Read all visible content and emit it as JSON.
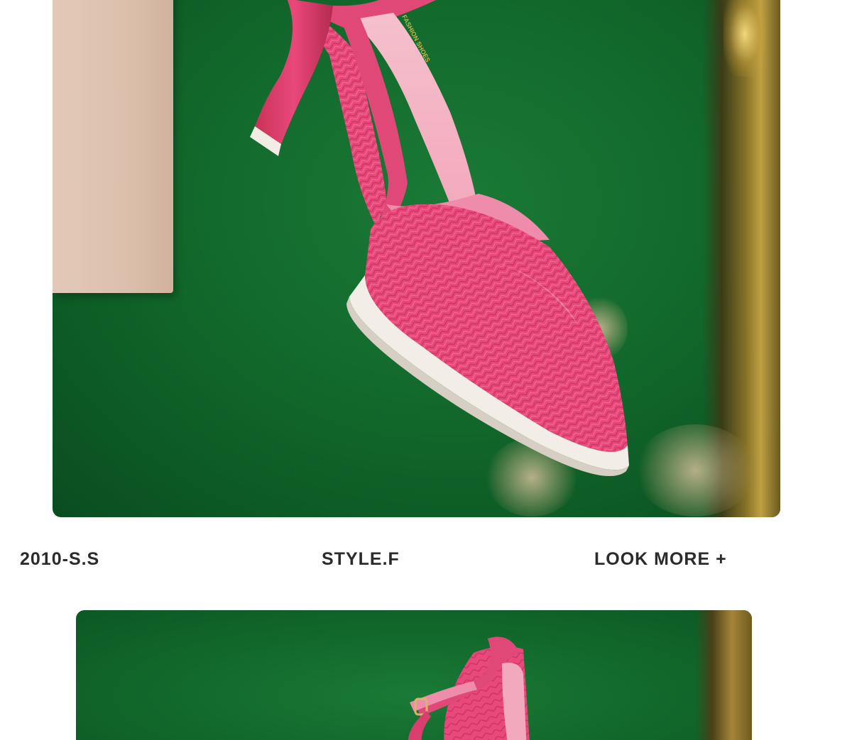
{
  "captions": {
    "season": "2010-S.S",
    "style": "STYLE.F",
    "look_more": "LOOK MORE +"
  },
  "insole_print": "FASHION SHOES",
  "colors": {
    "background": "#ffffff",
    "backdrop_green": "#12692c",
    "shoe_pink": "#e9487a",
    "sole_white": "#f2ede6",
    "frame_gold": "#c9a444",
    "caption_text": "#2b2b2b"
  }
}
